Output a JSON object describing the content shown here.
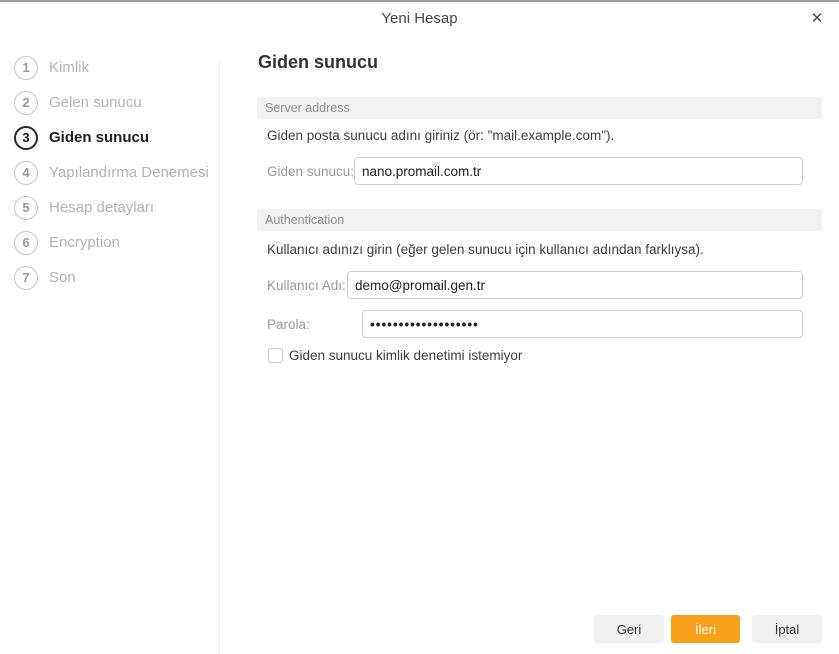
{
  "window": {
    "title": "Yeni Hesap",
    "close_icon": "✕"
  },
  "colors": {
    "accent_orange": "#F9A11B",
    "focus_blue": "#2A7CD9",
    "section_bar_bg": "#F2F2F2"
  },
  "steps": [
    {
      "num": "1",
      "label": "Kimlik",
      "active": false
    },
    {
      "num": "2",
      "label": "Gelen sunucu",
      "active": false
    },
    {
      "num": "3",
      "label": "Giden sunucu",
      "active": true
    },
    {
      "num": "4",
      "label": "Yapılandırma Denemesi",
      "active": false
    },
    {
      "num": "5",
      "label": "Hesap detayları",
      "active": false
    },
    {
      "num": "6",
      "label": "Encryption",
      "active": false
    },
    {
      "num": "7",
      "label": "Son",
      "active": false
    }
  ],
  "main": {
    "heading": "Giden sunucu",
    "server_section": {
      "header": "Server address",
      "description": "Giden posta sunucu adını giriniz (ör: \"mail.example.com\").",
      "field_label": "Giden sunucu:",
      "field_value": "nano.promail.com.tr"
    },
    "auth_section": {
      "header": "Authentication",
      "description": "Kullanıcı adınızı girin (eğer gelen sunucu için kullanıcı adından farklıysa).",
      "username_label": "Kullanıcı Adı:",
      "username_value": "demo@promail.gen.tr",
      "password_label": "Parola:",
      "password_value": "•••••••••••••••••••",
      "checkbox_label": "Giden sunucu kimlik denetimi istemiyor",
      "checkbox_checked": false
    }
  },
  "footer": {
    "back_label": "Geri",
    "next_label": "İleri",
    "cancel_label": "İptal"
  }
}
